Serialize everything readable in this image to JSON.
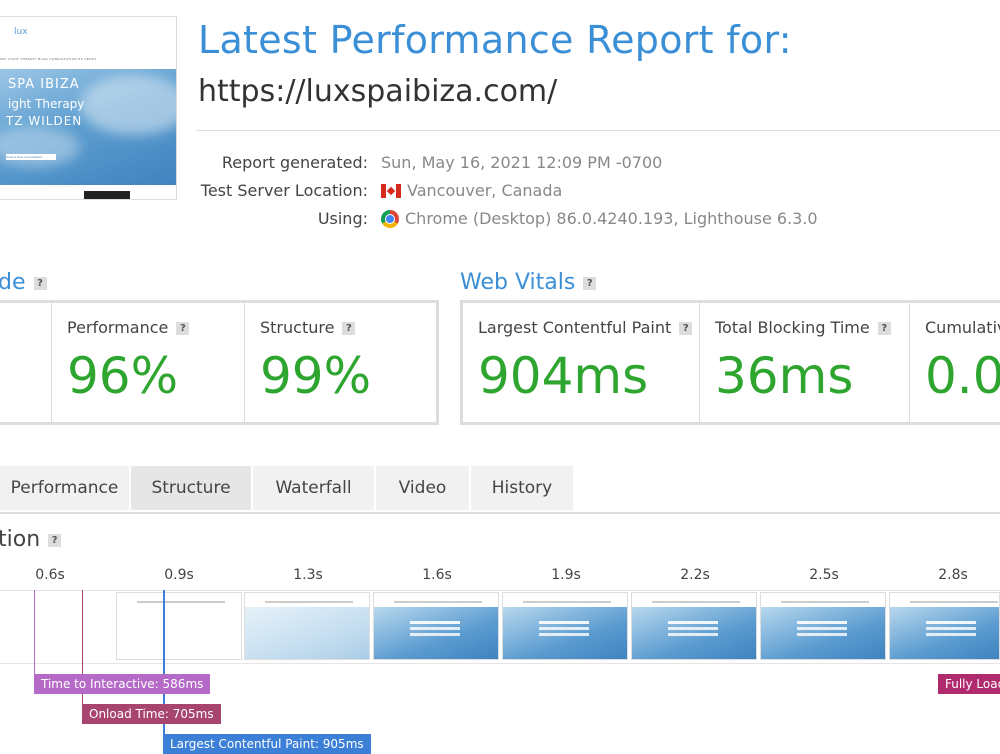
{
  "thumbnail": {
    "logo": "lux",
    "nav_text": "SPA  LIGHT THERAPY   BLOG   CONSULTATION   ES   ABOUT",
    "hero_line1": "SPA IBIZA",
    "hero_line2": "ight Therapy",
    "hero_line3": "TZ WILDEN",
    "cta": "book a free consultation"
  },
  "header": {
    "title": "Latest Performance Report for:",
    "url": "https://luxspaibiza.com/"
  },
  "meta": {
    "generated_label": "Report generated:",
    "generated_value": "Sun, May 16, 2021 12:09 PM -0700",
    "location_label": "Test Server Location:",
    "location_value": "Vancouver, Canada",
    "location_flag": "canada-flag-icon",
    "using_label": "Using:",
    "using_value": "Chrome (Desktop) 86.0.4240.193, Lighthouse 6.3.0",
    "using_icon": "chrome-icon"
  },
  "grade": {
    "heading": "de",
    "help": "?",
    "performance_label": "Performance",
    "performance_value": "96%",
    "structure_label": "Structure",
    "structure_value": "99%"
  },
  "web_vitals": {
    "heading": "Web Vitals",
    "help": "?",
    "lcp_label": "Largest Contentful Paint",
    "lcp_value": "904ms",
    "tbt_label": "Total Blocking Time",
    "tbt_value": "36ms",
    "cls_label": "Cumulativ",
    "cls_value": "0.0"
  },
  "tabs": [
    {
      "label": "Performance"
    },
    {
      "label": "Structure"
    },
    {
      "label": "Waterfall"
    },
    {
      "label": "Video"
    },
    {
      "label": "History"
    }
  ],
  "filmstrip": {
    "heading": "tion",
    "help": "?",
    "ticks": [
      "0.6s",
      "0.9s",
      "1.3s",
      "1.6s",
      "1.9s",
      "2.2s",
      "2.5s",
      "2.8s"
    ],
    "markers": {
      "tti": "Time to Interactive: 586ms",
      "onload": "Onload Time: 705ms",
      "lcp": "Largest Contentful Paint: 905ms",
      "fully": "Fully Load"
    },
    "colors": {
      "tti": "#b56ac7",
      "onload": "#a8456f",
      "lcp": "#3b7fd6",
      "fully": "#b02a6e"
    }
  },
  "colors": {
    "accent": "#3b8fd6",
    "score_green": "#2ea52e"
  }
}
